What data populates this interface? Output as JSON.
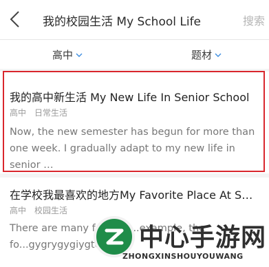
{
  "header": {
    "title": "我的校园生活 My School Life",
    "search_label": "搜索"
  },
  "filters": {
    "grade_label": "高中",
    "topic_label": "题材"
  },
  "articles": [
    {
      "title": "我的高中新生活 My New Life In Senior School",
      "level": "高中",
      "category": "日常生活",
      "excerpt": "Now, the new semester has begun for more than one week. I gradually adapt to my new life in senior …"
    },
    {
      "title": "在学校我最喜欢的地方My Favorite Place At S…",
      "level": "高中",
      "category": "校园生活",
      "excerpt": "There are many f...laces...example, the fo...gygrygygiygtce"
    }
  ],
  "watermark": {
    "name_cn": "中心手游网",
    "name_en": "ZHONGXINSHOUYOUWANG"
  },
  "colors": {
    "highlight": "#d9262c",
    "accent": "#3d8de0",
    "watermark_green": "#1f8c49"
  }
}
